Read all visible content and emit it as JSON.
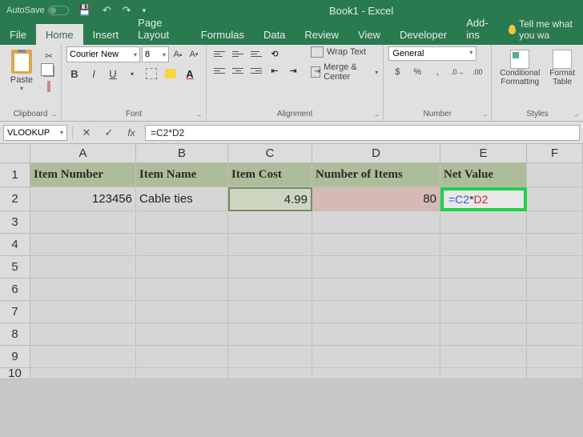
{
  "title_bar": {
    "autosave": "AutoSave",
    "title": "Book1 - Excel"
  },
  "tabs": {
    "file": "File",
    "home": "Home",
    "insert": "Insert",
    "page_layout": "Page Layout",
    "formulas": "Formulas",
    "data": "Data",
    "review": "Review",
    "view": "View",
    "developer": "Developer",
    "addins": "Add-ins",
    "tellme": "Tell me what you wa"
  },
  "ribbon": {
    "clipboard": {
      "paste": "Paste",
      "label": "Clipboard"
    },
    "font": {
      "name": "Courier New",
      "size": "8",
      "label": "Font"
    },
    "alignment": {
      "wrap": "Wrap Text",
      "merge": "Merge & Center",
      "label": "Alignment"
    },
    "number": {
      "format": "General",
      "label": "Number"
    },
    "styles": {
      "cf1": "Conditional",
      "cf2": "Formatting",
      "ft1": "Format",
      "ft2": "Table",
      "label": "Styles"
    }
  },
  "formula_bar": {
    "name_box": "VLOOKUP",
    "formula": "=C2*D2"
  },
  "columns": [
    "A",
    "B",
    "C",
    "D",
    "E",
    "F"
  ],
  "sheet": {
    "headers": {
      "A": "Item Number",
      "B": "Item Name",
      "C": "Item Cost",
      "D": "Number of Items",
      "E": "Net Value"
    },
    "row2": {
      "A": "123456",
      "B": "Cable ties",
      "C": "4.99",
      "D": "80",
      "E_c": "=C2",
      "E_op": "*",
      "E_d": "D2"
    }
  }
}
